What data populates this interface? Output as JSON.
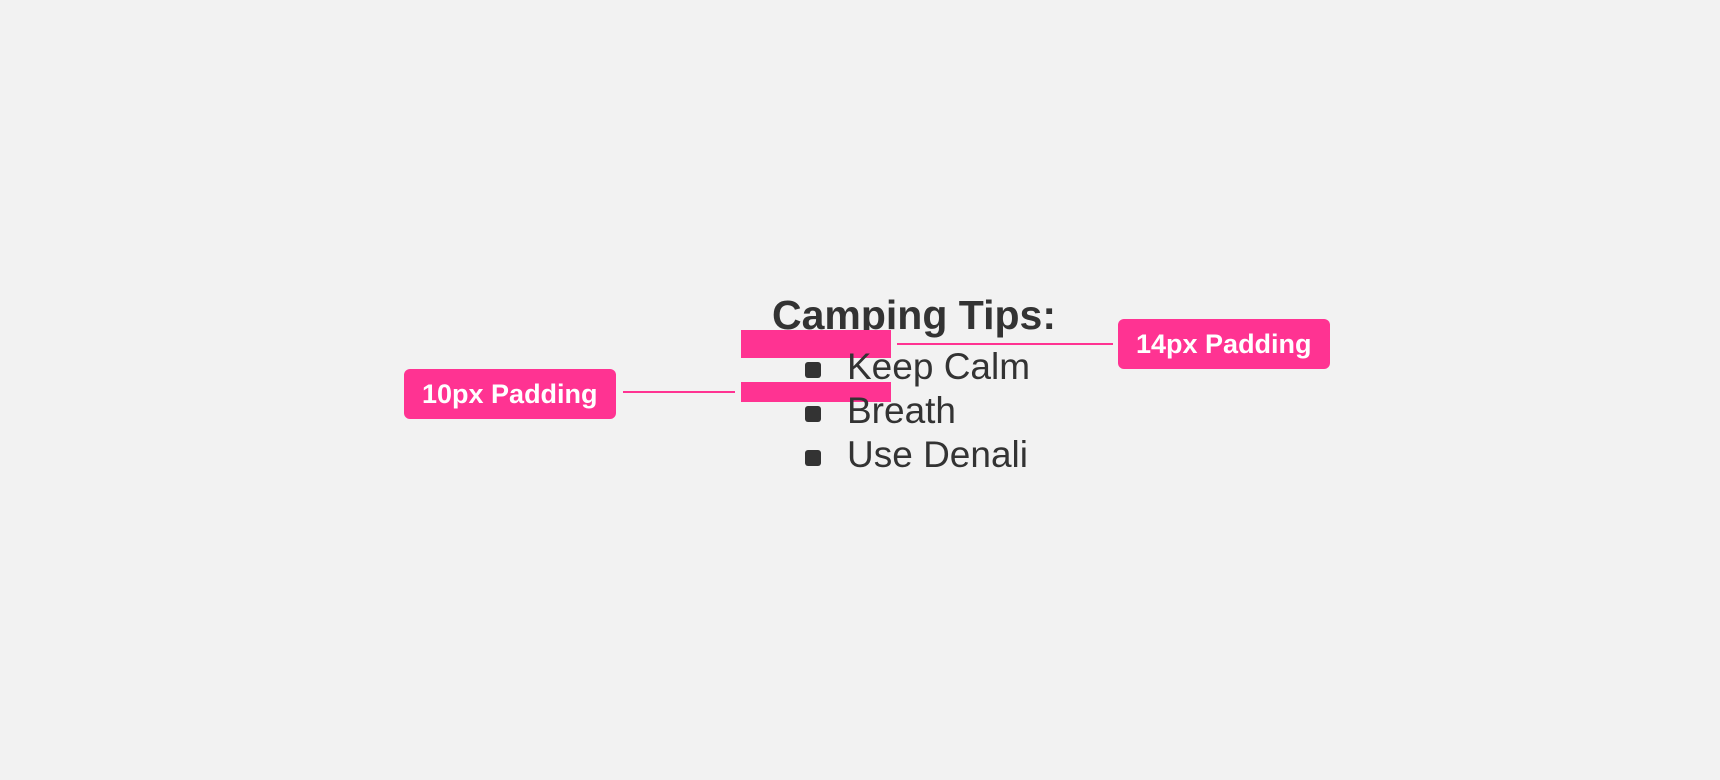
{
  "heading": "Camping Tips:",
  "tips": [
    "Keep Calm",
    "Breath",
    "Use Denali"
  ],
  "annotations": {
    "top_padding_label": "14px Padding",
    "bottom_padding_label": "10px Padding"
  },
  "colors": {
    "background": "#f2f2f2",
    "text": "#333333",
    "accent": "#ff3392",
    "callout_text": "#ffffff"
  }
}
